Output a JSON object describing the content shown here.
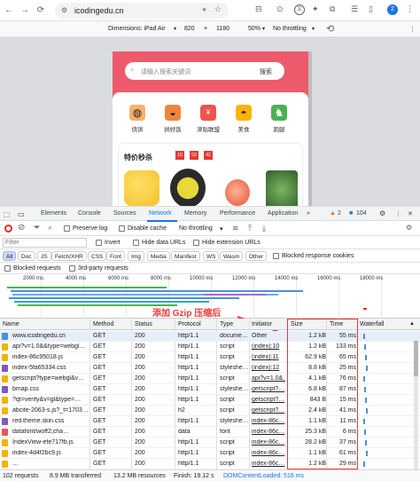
{
  "browser": {
    "url": "icodingedu.cn",
    "avatar_letter": "2"
  },
  "device_toolbar": {
    "dimensions_label": "Dimensions: iPad Air",
    "width": "820",
    "times": "×",
    "height": "1180",
    "zoom": "50%",
    "throttle": "No throttling"
  },
  "site": {
    "search_placeholder": "请输入搜索关键词",
    "search_button": "搜索",
    "categories": [
      "烧饼",
      "拼好饭",
      "津贴联盟",
      "美食",
      "跑腿"
    ],
    "flash_title": "特价秒杀",
    "timer": [
      "19",
      "53",
      "42"
    ]
  },
  "devtools": {
    "tabs": [
      "Elements",
      "Console",
      "Sources",
      "Network",
      "Memory",
      "Performance",
      "Application"
    ],
    "warn_count": "2",
    "info_count": "104",
    "preserve_log": "Preserve log",
    "disable_cache": "Disable cache",
    "throttle": "No throttling",
    "filter_placeholder": "Filter",
    "invert": "Invert",
    "hide_data_urls": "Hide data URLs",
    "hide_ext_urls": "Hide extension URLs",
    "type_filters": [
      "All",
      "Doc",
      "JS",
      "Fetch/XHR",
      "CSS",
      "Font",
      "Img",
      "Media",
      "Manifest",
      "WS",
      "Wasm",
      "Other"
    ],
    "blocked_cookies": "Blocked response cookies",
    "blocked_requests": "Blocked requests",
    "third_party": "3rd-party requests",
    "ticks": [
      "2000 ms",
      "4000 ms",
      "6000 ms",
      "8000 ms",
      "10000 ms",
      "12000 ms",
      "14000 ms",
      "16000 ms",
      "18000 ms"
    ],
    "columns": [
      "Name",
      "Method",
      "Status",
      "Protocol",
      "Type",
      "Initiator",
      "Size",
      "Time",
      "Waterfall"
    ],
    "annotation": "添加 Gzip 压缩后",
    "rows": [
      {
        "name": "www.icodingedu.cn",
        "method": "GET",
        "status": "200",
        "protocol": "http/1.1",
        "type": "docume…",
        "initiator": "Other",
        "size": "1.2 kB",
        "time": "55 ms"
      },
      {
        "name": "api?v=1.0&&type=webgl…",
        "method": "GET",
        "status": "200",
        "protocol": "http/1.1",
        "type": "script",
        "initiator": "(index):10",
        "size": "1.2 kB",
        "time": "133 ms"
      },
      {
        "name": "index-86c95018.js",
        "method": "GET",
        "status": "200",
        "protocol": "http/1.1",
        "type": "script",
        "initiator": "(index):11",
        "size": "62.9 kB",
        "time": "65 ms"
      },
      {
        "name": "index-5fa65334.css",
        "method": "GET",
        "status": "200",
        "protocol": "http/1.1",
        "type": "styleshe…",
        "initiator": "(index):12",
        "size": "8.8 kB",
        "time": "25 ms"
      },
      {
        "name": "getscript?type=webgl&v…",
        "method": "GET",
        "status": "200",
        "protocol": "http/1.1",
        "type": "script",
        "initiator": "api?v=1.0&…",
        "size": "4.1 kB",
        "time": "76 ms"
      },
      {
        "name": "bmap.css",
        "method": "GET",
        "status": "200",
        "protocol": "http/1.1",
        "type": "styleshe…",
        "initiator": "getscript?…",
        "size": "6.8 kB",
        "time": "87 ms"
      },
      {
        "name": "?qt=verify&v=gl&type=…",
        "method": "GET",
        "status": "200",
        "protocol": "http/1.1",
        "type": "script",
        "initiator": "getscript?…",
        "size": "843 B",
        "time": "15 ms"
      },
      {
        "name": "abcite-2063-s.js?_t=1703…",
        "method": "GET",
        "status": "200",
        "protocol": "h2",
        "type": "script",
        "initiator": "getscript?…",
        "size": "2.4 kB",
        "time": "41 ms"
      },
      {
        "name": "red.theme.skin.css",
        "method": "GET",
        "status": "200",
        "protocol": "http/1.1",
        "type": "styleshe…",
        "initiator": "index-86c…",
        "size": "1.1 kB",
        "time": "11 ms"
      },
      {
        "name": "datafont/woff2;cha…",
        "method": "GET",
        "status": "200",
        "protocol": "data",
        "type": "font",
        "initiator": "index-86c…",
        "size": "25.3 kB",
        "time": "6 ms"
      },
      {
        "name": "IndexView-efe717fb.js",
        "method": "GET",
        "status": "200",
        "protocol": "http/1.1",
        "type": "script",
        "initiator": "index-86c…",
        "size": "28.2 kB",
        "time": "37 ms"
      },
      {
        "name": "index-4d4f2bc9.js",
        "method": "GET",
        "status": "200",
        "protocol": "http/1.1",
        "type": "script",
        "initiator": "index-86c…",
        "size": "1.1 kB",
        "time": "61 ms"
      },
      {
        "name": "…",
        "method": "GET",
        "status": "200",
        "protocol": "http/1.1",
        "type": "script",
        "initiator": "index-86c…",
        "size": "1.2 kB",
        "time": "29 ms"
      }
    ],
    "footer": {
      "requests": "102 requests",
      "transferred": "8.9 MB transferred",
      "resources": "13.2 MB resources",
      "finish": "Finish: 19.12 s",
      "dcl": "DOMContentLoaded: 516 ms"
    }
  }
}
